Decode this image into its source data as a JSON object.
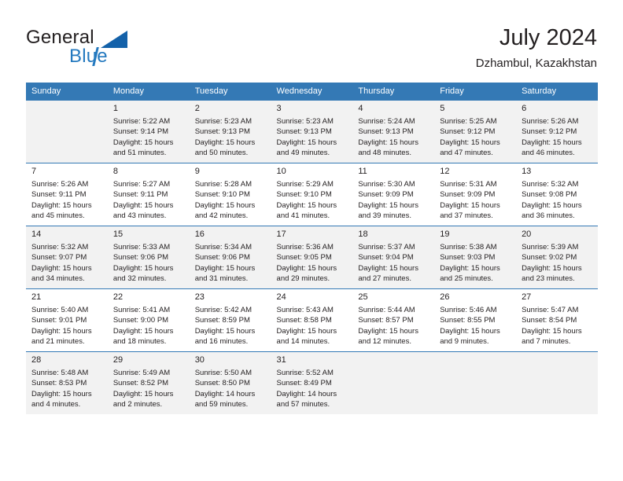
{
  "brand": {
    "name_part1": "General",
    "name_part2": "Blue",
    "accent_color": "#2479bf",
    "triangle_color": "#1361a9"
  },
  "header": {
    "month_title": "July 2024",
    "location": "Dzhambul, Kazakhstan"
  },
  "calendar": {
    "header_bg": "#3479b5",
    "shaded_row_bg": "#f2f2f2",
    "weekdays": [
      "Sunday",
      "Monday",
      "Tuesday",
      "Wednesday",
      "Thursday",
      "Friday",
      "Saturday"
    ],
    "weeks": [
      [
        {
          "day": "",
          "blank": true
        },
        {
          "day": "1",
          "sunrise": "Sunrise: 5:22 AM",
          "sunset": "Sunset: 9:14 PM",
          "daylight1": "Daylight: 15 hours",
          "daylight2": "and 51 minutes."
        },
        {
          "day": "2",
          "sunrise": "Sunrise: 5:23 AM",
          "sunset": "Sunset: 9:13 PM",
          "daylight1": "Daylight: 15 hours",
          "daylight2": "and 50 minutes."
        },
        {
          "day": "3",
          "sunrise": "Sunrise: 5:23 AM",
          "sunset": "Sunset: 9:13 PM",
          "daylight1": "Daylight: 15 hours",
          "daylight2": "and 49 minutes."
        },
        {
          "day": "4",
          "sunrise": "Sunrise: 5:24 AM",
          "sunset": "Sunset: 9:13 PM",
          "daylight1": "Daylight: 15 hours",
          "daylight2": "and 48 minutes."
        },
        {
          "day": "5",
          "sunrise": "Sunrise: 5:25 AM",
          "sunset": "Sunset: 9:12 PM",
          "daylight1": "Daylight: 15 hours",
          "daylight2": "and 47 minutes."
        },
        {
          "day": "6",
          "sunrise": "Sunrise: 5:26 AM",
          "sunset": "Sunset: 9:12 PM",
          "daylight1": "Daylight: 15 hours",
          "daylight2": "and 46 minutes."
        }
      ],
      [
        {
          "day": "7",
          "sunrise": "Sunrise: 5:26 AM",
          "sunset": "Sunset: 9:11 PM",
          "daylight1": "Daylight: 15 hours",
          "daylight2": "and 45 minutes."
        },
        {
          "day": "8",
          "sunrise": "Sunrise: 5:27 AM",
          "sunset": "Sunset: 9:11 PM",
          "daylight1": "Daylight: 15 hours",
          "daylight2": "and 43 minutes."
        },
        {
          "day": "9",
          "sunrise": "Sunrise: 5:28 AM",
          "sunset": "Sunset: 9:10 PM",
          "daylight1": "Daylight: 15 hours",
          "daylight2": "and 42 minutes."
        },
        {
          "day": "10",
          "sunrise": "Sunrise: 5:29 AM",
          "sunset": "Sunset: 9:10 PM",
          "daylight1": "Daylight: 15 hours",
          "daylight2": "and 41 minutes."
        },
        {
          "day": "11",
          "sunrise": "Sunrise: 5:30 AM",
          "sunset": "Sunset: 9:09 PM",
          "daylight1": "Daylight: 15 hours",
          "daylight2": "and 39 minutes."
        },
        {
          "day": "12",
          "sunrise": "Sunrise: 5:31 AM",
          "sunset": "Sunset: 9:09 PM",
          "daylight1": "Daylight: 15 hours",
          "daylight2": "and 37 minutes."
        },
        {
          "day": "13",
          "sunrise": "Sunrise: 5:32 AM",
          "sunset": "Sunset: 9:08 PM",
          "daylight1": "Daylight: 15 hours",
          "daylight2": "and 36 minutes."
        }
      ],
      [
        {
          "day": "14",
          "sunrise": "Sunrise: 5:32 AM",
          "sunset": "Sunset: 9:07 PM",
          "daylight1": "Daylight: 15 hours",
          "daylight2": "and 34 minutes."
        },
        {
          "day": "15",
          "sunrise": "Sunrise: 5:33 AM",
          "sunset": "Sunset: 9:06 PM",
          "daylight1": "Daylight: 15 hours",
          "daylight2": "and 32 minutes."
        },
        {
          "day": "16",
          "sunrise": "Sunrise: 5:34 AM",
          "sunset": "Sunset: 9:06 PM",
          "daylight1": "Daylight: 15 hours",
          "daylight2": "and 31 minutes."
        },
        {
          "day": "17",
          "sunrise": "Sunrise: 5:36 AM",
          "sunset": "Sunset: 9:05 PM",
          "daylight1": "Daylight: 15 hours",
          "daylight2": "and 29 minutes."
        },
        {
          "day": "18",
          "sunrise": "Sunrise: 5:37 AM",
          "sunset": "Sunset: 9:04 PM",
          "daylight1": "Daylight: 15 hours",
          "daylight2": "and 27 minutes."
        },
        {
          "day": "19",
          "sunrise": "Sunrise: 5:38 AM",
          "sunset": "Sunset: 9:03 PM",
          "daylight1": "Daylight: 15 hours",
          "daylight2": "and 25 minutes."
        },
        {
          "day": "20",
          "sunrise": "Sunrise: 5:39 AM",
          "sunset": "Sunset: 9:02 PM",
          "daylight1": "Daylight: 15 hours",
          "daylight2": "and 23 minutes."
        }
      ],
      [
        {
          "day": "21",
          "sunrise": "Sunrise: 5:40 AM",
          "sunset": "Sunset: 9:01 PM",
          "daylight1": "Daylight: 15 hours",
          "daylight2": "and 21 minutes."
        },
        {
          "day": "22",
          "sunrise": "Sunrise: 5:41 AM",
          "sunset": "Sunset: 9:00 PM",
          "daylight1": "Daylight: 15 hours",
          "daylight2": "and 18 minutes."
        },
        {
          "day": "23",
          "sunrise": "Sunrise: 5:42 AM",
          "sunset": "Sunset: 8:59 PM",
          "daylight1": "Daylight: 15 hours",
          "daylight2": "and 16 minutes."
        },
        {
          "day": "24",
          "sunrise": "Sunrise: 5:43 AM",
          "sunset": "Sunset: 8:58 PM",
          "daylight1": "Daylight: 15 hours",
          "daylight2": "and 14 minutes."
        },
        {
          "day": "25",
          "sunrise": "Sunrise: 5:44 AM",
          "sunset": "Sunset: 8:57 PM",
          "daylight1": "Daylight: 15 hours",
          "daylight2": "and 12 minutes."
        },
        {
          "day": "26",
          "sunrise": "Sunrise: 5:46 AM",
          "sunset": "Sunset: 8:55 PM",
          "daylight1": "Daylight: 15 hours",
          "daylight2": "and 9 minutes."
        },
        {
          "day": "27",
          "sunrise": "Sunrise: 5:47 AM",
          "sunset": "Sunset: 8:54 PM",
          "daylight1": "Daylight: 15 hours",
          "daylight2": "and 7 minutes."
        }
      ],
      [
        {
          "day": "28",
          "sunrise": "Sunrise: 5:48 AM",
          "sunset": "Sunset: 8:53 PM",
          "daylight1": "Daylight: 15 hours",
          "daylight2": "and 4 minutes."
        },
        {
          "day": "29",
          "sunrise": "Sunrise: 5:49 AM",
          "sunset": "Sunset: 8:52 PM",
          "daylight1": "Daylight: 15 hours",
          "daylight2": "and 2 minutes."
        },
        {
          "day": "30",
          "sunrise": "Sunrise: 5:50 AM",
          "sunset": "Sunset: 8:50 PM",
          "daylight1": "Daylight: 14 hours",
          "daylight2": "and 59 minutes."
        },
        {
          "day": "31",
          "sunrise": "Sunrise: 5:52 AM",
          "sunset": "Sunset: 8:49 PM",
          "daylight1": "Daylight: 14 hours",
          "daylight2": "and 57 minutes."
        },
        {
          "day": "",
          "blank": true
        },
        {
          "day": "",
          "blank": true
        },
        {
          "day": "",
          "blank": true
        }
      ]
    ]
  }
}
